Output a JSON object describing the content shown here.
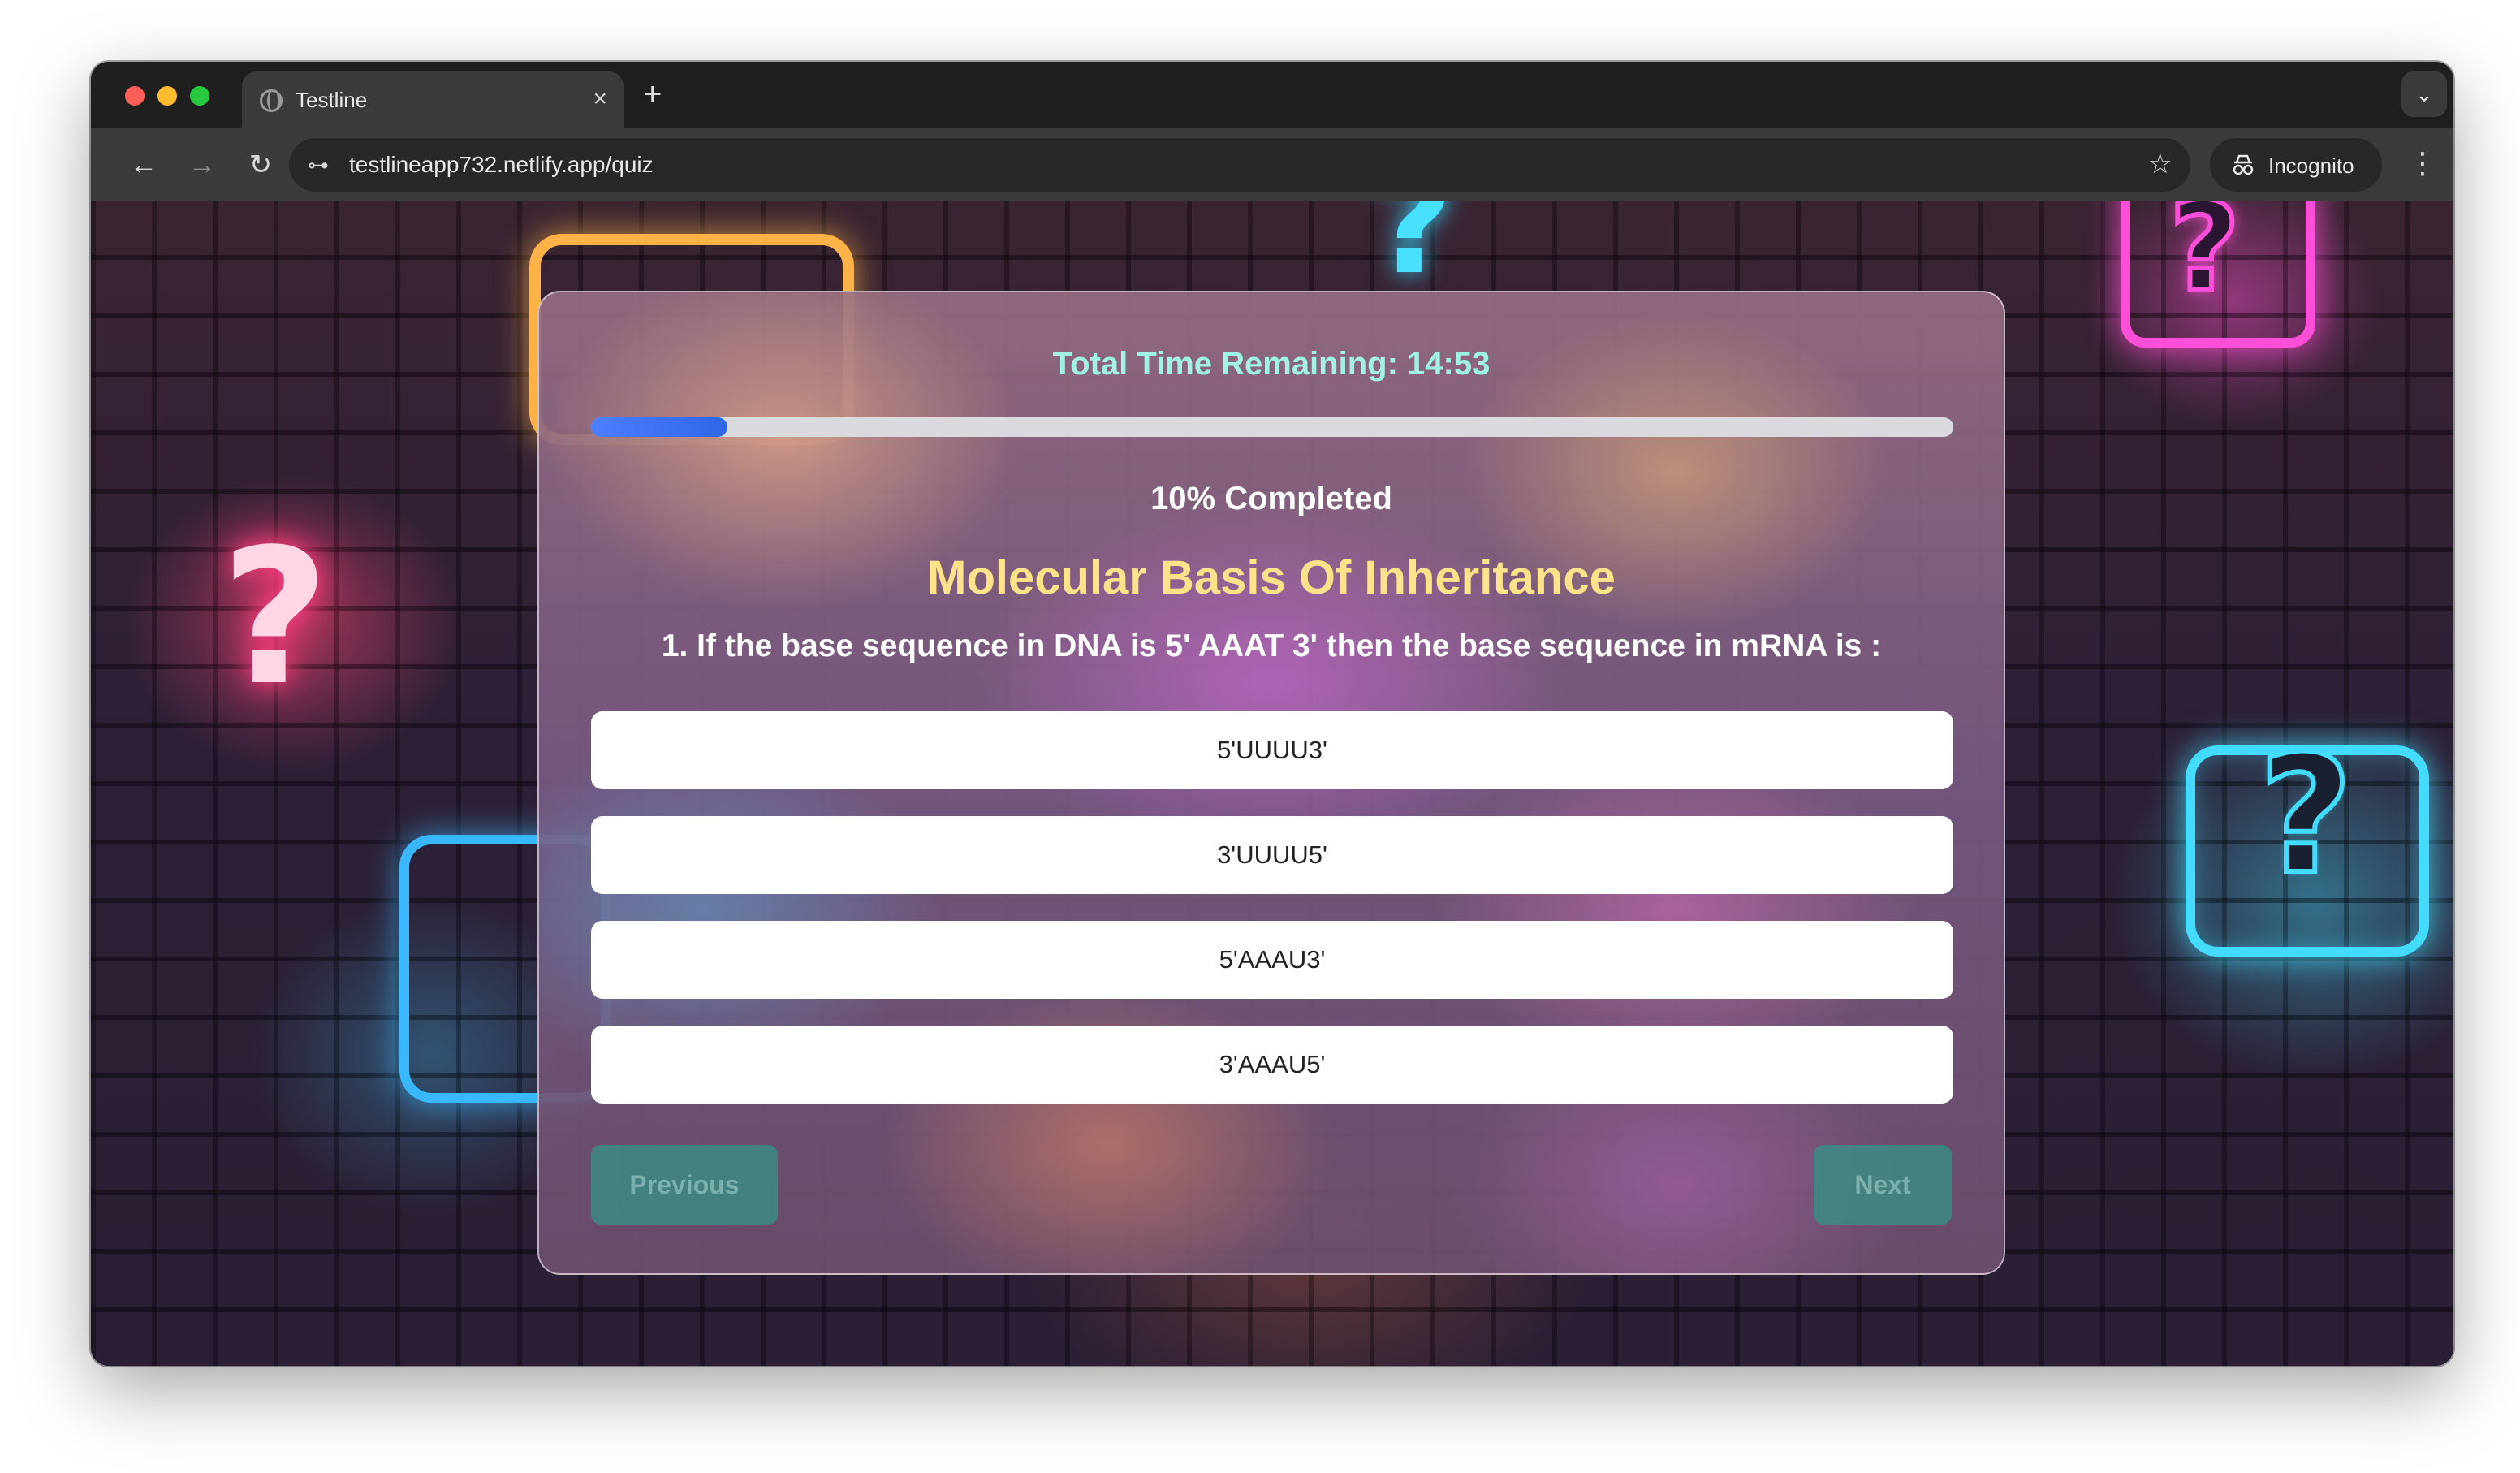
{
  "browser": {
    "tab_title": "Testline",
    "tab_close": "×",
    "new_tab": "+",
    "tab_dropdown": "⌄",
    "nav": {
      "back": "←",
      "forward": "→",
      "reload": "↻"
    },
    "site_info": "⊶",
    "url": "testlineapp732.netlify.app/quiz",
    "bookmark": "☆",
    "incognito_label": "Incognito",
    "menu": "⋮"
  },
  "quiz": {
    "timer_text": "Total Time Remaining: 14:53",
    "progress_fraction": 0.1,
    "progress_text": "10% Completed",
    "subject": "Molecular Basis Of Inheritance",
    "question": "1. If the base sequence in DNA is 5' AAAT 3' then the base sequence in mRNA is :",
    "options": [
      "5'UUUU3'",
      "3'UUUU5'",
      "5'AAAU3'",
      "3'AAAU5'"
    ],
    "previous_label": "Previous",
    "next_label": "Next"
  },
  "colors": {
    "timer": "#9ff2e4",
    "subject": "#ffe38a",
    "progress_fill": "#2f66e8",
    "nav_button_bg": "#3d8b84"
  },
  "icons": {
    "traffic_lights": [
      "close-dot",
      "minimize-dot",
      "zoom-dot"
    ],
    "tab_favicon": "globe-icon",
    "incognito": "incognito-icon"
  }
}
